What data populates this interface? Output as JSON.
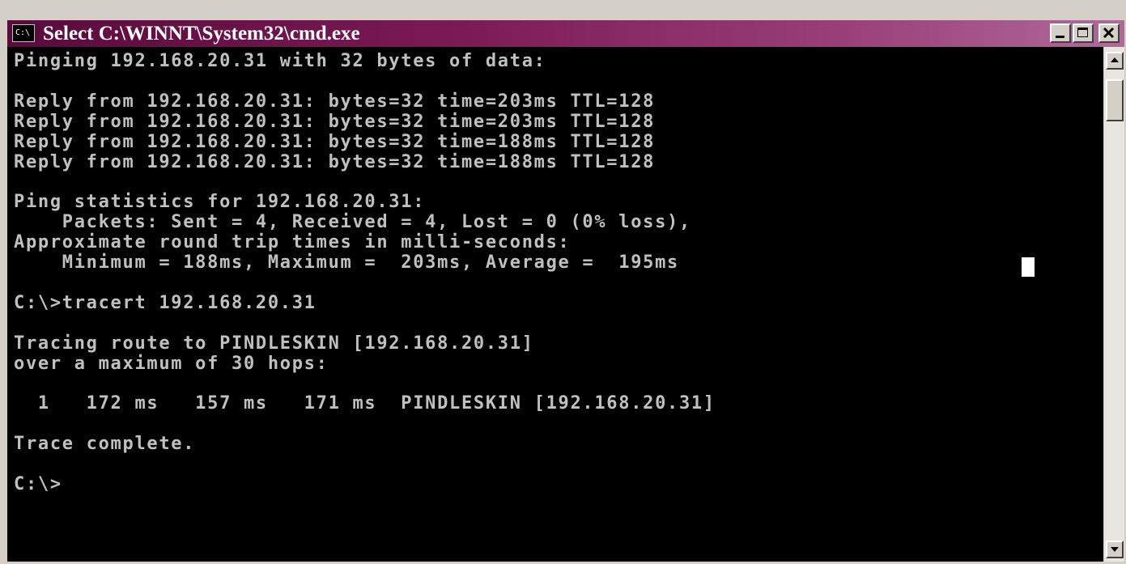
{
  "window": {
    "title": "Select C:\\WINNT\\System32\\cmd.exe",
    "icon_label": "C:\\",
    "icon": "console-app-icon",
    "minimize_icon": "minimize-icon",
    "maximize_icon": "maximize-icon",
    "close_icon": "close-icon"
  },
  "console": {
    "lines": [
      "Pinging 192.168.20.31 with 32 bytes of data:",
      "",
      "Reply from 192.168.20.31: bytes=32 time=203ms TTL=128",
      "Reply from 192.168.20.31: bytes=32 time=203ms TTL=128",
      "Reply from 192.168.20.31: bytes=32 time=188ms TTL=128",
      "Reply from 192.168.20.31: bytes=32 time=188ms TTL=128",
      "",
      "Ping statistics for 192.168.20.31:",
      "    Packets: Sent = 4, Received = 4, Lost = 0 (0% loss),",
      "Approximate round trip times in milli-seconds:",
      "    Minimum = 188ms, Maximum =  203ms, Average =  195ms",
      "",
      "C:\\>tracert 192.168.20.31",
      "",
      "Tracing route to PINDLESKIN [192.168.20.31]",
      "over a maximum of 30 hops:",
      "",
      "  1   172 ms   157 ms   171 ms  PINDLESKIN [192.168.20.31]",
      "",
      "Trace complete.",
      "",
      "C:\\>"
    ]
  },
  "scrollbar": {
    "up_icon": "scroll-up-arrow-icon",
    "down_icon": "scroll-down-arrow-icon"
  },
  "colors": {
    "title_bar_start": "#5a0a3c",
    "title_bar_end": "#b06a9a",
    "console_background": "#000000",
    "console_text": "#c0c0c0"
  }
}
